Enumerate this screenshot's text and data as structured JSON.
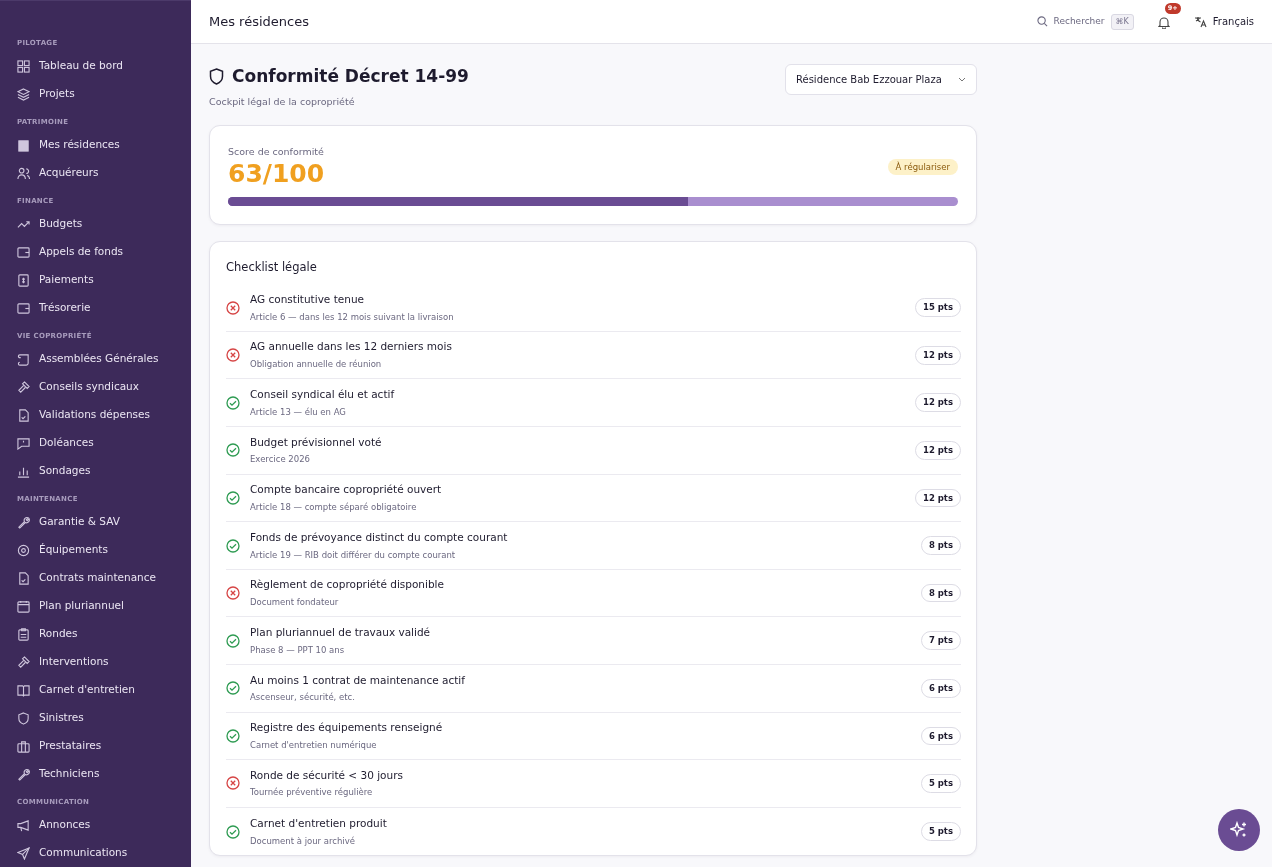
{
  "sidebar": {
    "sections": [
      {
        "heading": "PILOTAGE",
        "items": [
          {
            "label": "Tableau de bord"
          },
          {
            "label": "Projets"
          }
        ]
      },
      {
        "heading": "PATRIMOINE",
        "items": [
          {
            "label": "Mes résidences"
          },
          {
            "label": "Acquéreurs"
          }
        ]
      },
      {
        "heading": "FINANCE",
        "items": [
          {
            "label": "Budgets"
          },
          {
            "label": "Appels de fonds"
          },
          {
            "label": "Paiements"
          },
          {
            "label": "Trésorerie"
          }
        ]
      },
      {
        "heading": "VIE COPROPRIÉTÉ",
        "items": [
          {
            "label": "Assemblées Générales"
          },
          {
            "label": "Conseils syndicaux"
          },
          {
            "label": "Validations dépenses"
          },
          {
            "label": "Doléances"
          },
          {
            "label": "Sondages"
          }
        ]
      },
      {
        "heading": "MAINTENANCE",
        "items": [
          {
            "label": "Garantie & SAV"
          },
          {
            "label": "Équipements"
          },
          {
            "label": "Contrats maintenance"
          },
          {
            "label": "Plan pluriannuel"
          },
          {
            "label": "Rondes"
          },
          {
            "label": "Interventions"
          },
          {
            "label": "Carnet d'entretien"
          },
          {
            "label": "Sinistres"
          },
          {
            "label": "Prestataires"
          },
          {
            "label": "Techniciens"
          }
        ]
      },
      {
        "heading": "COMMUNICATION",
        "items": [
          {
            "label": "Annonces"
          },
          {
            "label": "Communications"
          }
        ]
      }
    ]
  },
  "topbar": {
    "title": "Mes résidences",
    "search": {
      "label": "Rechercher",
      "shortcut": "⌘K"
    },
    "notifications": {
      "count": "9+"
    },
    "language": "Français"
  },
  "header": {
    "title": "Conformité Décret 14-99",
    "subtitle": "Cockpit légal de la copropriété",
    "residence": "Résidence Bab Ezzouar Plaza"
  },
  "score": {
    "label": "Score de conformité",
    "value": "63/100",
    "status": "À régulariser",
    "level": 0.63
  },
  "checklist": {
    "title": "Checklist légale",
    "items": [
      {
        "title": "AG constitutive tenue",
        "detail": "Article 6 — dans les 12 mois suivant la livraison",
        "points": "15 pts",
        "done": false
      },
      {
        "title": "AG annuelle dans les 12 derniers mois",
        "detail": "Obligation annuelle de réunion",
        "points": "12 pts",
        "done": false
      },
      {
        "title": "Conseil syndical élu et actif",
        "detail": "Article 13 — élu en AG",
        "points": "12 pts",
        "done": true
      },
      {
        "title": "Budget prévisionnel voté",
        "detail": "Exercice 2026",
        "points": "12 pts",
        "done": true
      },
      {
        "title": "Compte bancaire copropriété ouvert",
        "detail": "Article 18 — compte séparé obligatoire",
        "points": "12 pts",
        "done": true
      },
      {
        "title": "Fonds de prévoyance distinct du compte courant",
        "detail": "Article 19 — RIB doit différer du compte courant",
        "points": "8 pts",
        "done": true
      },
      {
        "title": "Règlement de copropriété disponible",
        "detail": "Document fondateur",
        "points": "8 pts",
        "done": false
      },
      {
        "title": "Plan pluriannuel de travaux validé",
        "detail": "Phase 8 — PPT 10 ans",
        "points": "7 pts",
        "done": true
      },
      {
        "title": "Au moins 1 contrat de maintenance actif",
        "detail": "Ascenseur, sécurité, etc.",
        "points": "6 pts",
        "done": true
      },
      {
        "title": "Registre des équipements renseigné",
        "detail": "Carnet d'entretien numérique",
        "points": "6 pts",
        "done": true
      },
      {
        "title": "Ronde de sécurité < 30 jours",
        "detail": "Tournée préventive régulière",
        "points": "5 pts",
        "done": false
      },
      {
        "title": "Carnet d'entretien produit",
        "detail": "Document à jour archivé",
        "points": "5 pts",
        "done": true
      }
    ]
  }
}
